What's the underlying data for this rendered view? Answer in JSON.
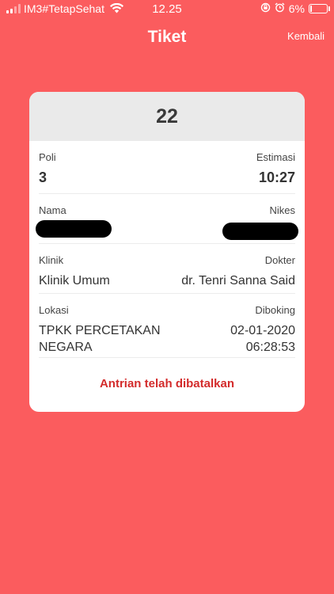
{
  "status_bar": {
    "carrier": "IM3#TetapSehat",
    "time": "12.25",
    "battery": "6%"
  },
  "nav": {
    "title": "Tiket",
    "back_label": "Kembali"
  },
  "ticket": {
    "queue_number": "22",
    "poli_label": "Poli",
    "poli_value": "3",
    "estimasi_label": "Estimasi",
    "estimasi_value": "10:27",
    "nama_label": "Nama",
    "nikes_label": "Nikes",
    "klinik_label": "Klinik",
    "klinik_value": "Klinik Umum",
    "dokter_label": "Dokter",
    "dokter_value": "dr. Tenri Sanna Said",
    "lokasi_label": "Lokasi",
    "lokasi_line1": "TPKK PERCETAKAN",
    "lokasi_line2": "NEGARA",
    "diboking_label": "Diboking",
    "diboking_date": "02-01-2020",
    "diboking_time": "06:28:53",
    "status_text": "Antrian telah dibatalkan"
  },
  "colors": {
    "background": "#fb5c5e",
    "card": "#ffffff",
    "header": "#eaeaea",
    "status_red": "#d32b2b"
  }
}
